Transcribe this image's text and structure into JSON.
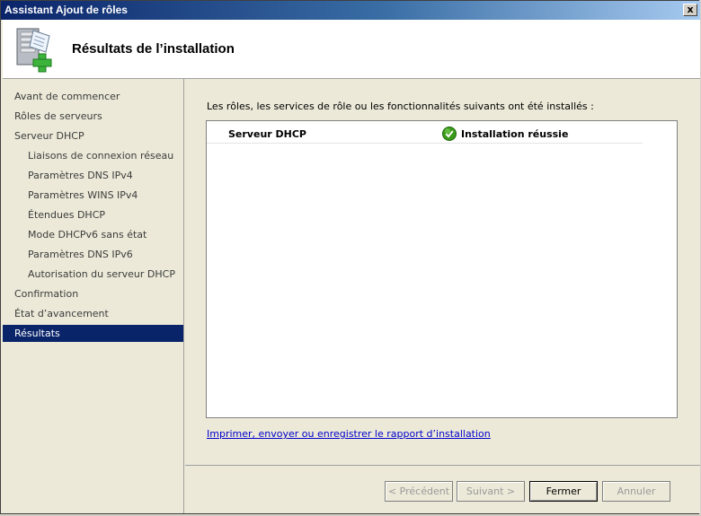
{
  "window": {
    "title": "Assistant Ajout de rôles",
    "close_label": "x"
  },
  "header": {
    "title": "Résultats de l’installation",
    "icon": "server-add-icon"
  },
  "nav": {
    "items": [
      {
        "label": "Avant de commencer",
        "level": 0,
        "selected": false
      },
      {
        "label": "Rôles de serveurs",
        "level": 0,
        "selected": false
      },
      {
        "label": "Serveur DHCP",
        "level": 0,
        "selected": false
      },
      {
        "label": "Liaisons de connexion réseau",
        "level": 1,
        "selected": false
      },
      {
        "label": "Paramètres DNS IPv4",
        "level": 1,
        "selected": false
      },
      {
        "label": "Paramètres WINS IPv4",
        "level": 1,
        "selected": false
      },
      {
        "label": "Étendues DHCP",
        "level": 1,
        "selected": false
      },
      {
        "label": "Mode DHCPv6 sans état",
        "level": 1,
        "selected": false
      },
      {
        "label": "Paramètres DNS IPv6",
        "level": 1,
        "selected": false
      },
      {
        "label": "Autorisation du serveur DHCP",
        "level": 1,
        "selected": false
      },
      {
        "label": "Confirmation",
        "level": 0,
        "selected": false
      },
      {
        "label": "État d’avancement",
        "level": 0,
        "selected": false
      },
      {
        "label": "Résultats",
        "level": 0,
        "selected": true
      }
    ],
    "selected_color": "#0a246a"
  },
  "content": {
    "intro": "Les rôles, les services de rôle ou les fonctionnalités suivants ont été installés :",
    "results": [
      {
        "name": "Serveur DHCP",
        "status": "Installation réussie",
        "status_icon": "success-check-icon"
      }
    ],
    "report_link": "Imprimer, envoyer ou enregistrer le rapport d’installation",
    "success_color": "#3a9a1a",
    "link_color": "#0000cc"
  },
  "footer": {
    "previous_label": "< Précédent",
    "next_label": "Suivant >",
    "close_label": "Fermer",
    "cancel_label": "Annuler"
  }
}
